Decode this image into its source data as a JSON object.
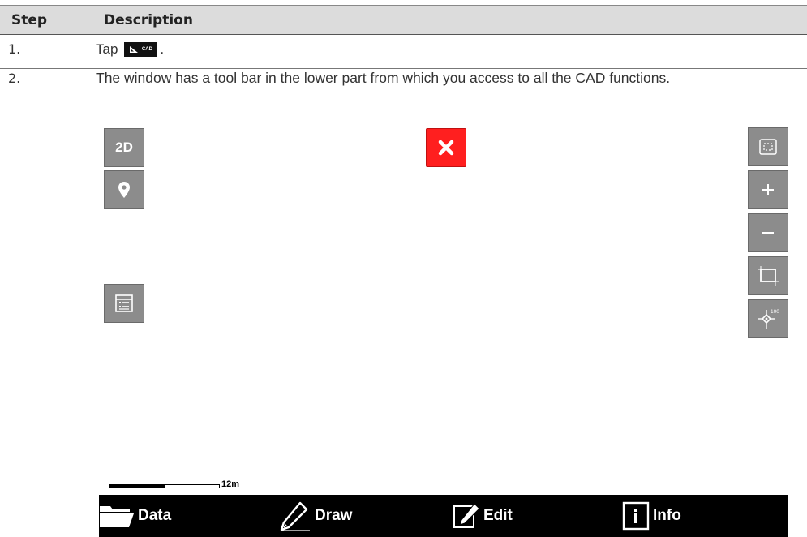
{
  "table": {
    "headers": {
      "step": "Step",
      "description": "Description"
    },
    "rows": [
      {
        "step": "1.",
        "text_before": "Tap",
        "text_after": ".",
        "button_label": "CAD"
      },
      {
        "step": "2.",
        "text": "The window has a tool bar in the lower part from which you access to all the CAD functions."
      }
    ]
  },
  "screen": {
    "map_buttons": {
      "mode_label": "2D",
      "center_zoom_label": "100"
    },
    "scale_bar": {
      "label": "12m"
    },
    "toolbar": [
      {
        "label": "Data",
        "icon": "folder-icon"
      },
      {
        "label": "Draw",
        "icon": "pencil-icon"
      },
      {
        "label": "Edit",
        "icon": "edit-icon"
      },
      {
        "label": "Info",
        "icon": "info-icon"
      }
    ],
    "colors": {
      "button_gray": "#8c8c8c",
      "close_red": "#ff1f1f",
      "toolbar_black": "#000000"
    }
  }
}
